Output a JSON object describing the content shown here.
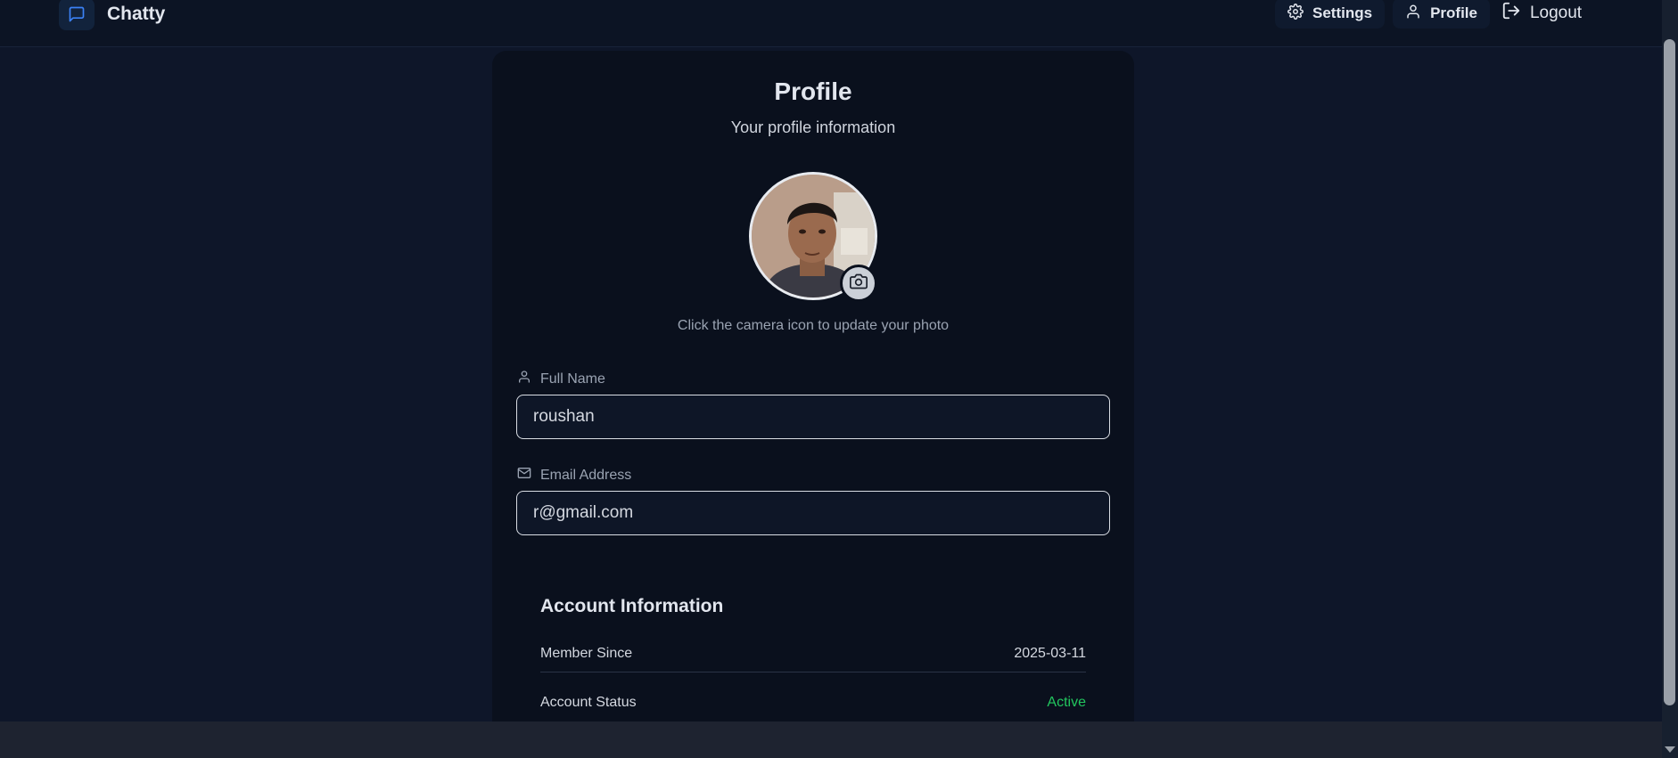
{
  "header": {
    "brand": "Chatty",
    "nav": {
      "settings": "Settings",
      "profile": "Profile",
      "logout": "Logout"
    }
  },
  "profile": {
    "title": "Profile",
    "subtitle": "Your profile information",
    "photo_hint": "Click the camera icon to update your photo",
    "full_name": {
      "label": "Full Name",
      "value": "roushan"
    },
    "email": {
      "label": "Email Address",
      "value": "r@gmail.com"
    }
  },
  "account": {
    "title": "Account Information",
    "rows": [
      {
        "label": "Member Since",
        "value": "2025-03-11"
      },
      {
        "label": "Account Status",
        "value": "Active"
      }
    ]
  },
  "colors": {
    "accent": "#3b82f6",
    "status_active": "#22c55e",
    "background": "#0e1629"
  }
}
